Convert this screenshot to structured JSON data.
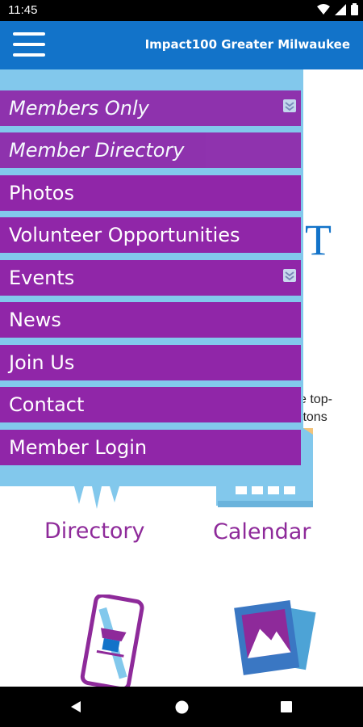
{
  "status_bar": {
    "time": "11:45"
  },
  "app_bar": {
    "title": "Impact100 Greater Milwaukee"
  },
  "menu": {
    "items": [
      {
        "label": "Members Only",
        "italic": true,
        "expandable": true
      },
      {
        "label": "Member Directory",
        "italic": true,
        "expandable": false
      },
      {
        "label": "Photos",
        "italic": false,
        "expandable": false
      },
      {
        "label": "Volunteer Opportunities",
        "italic": false,
        "expandable": false
      },
      {
        "label": "Events",
        "italic": false,
        "expandable": true
      },
      {
        "label": "News",
        "italic": false,
        "expandable": false
      },
      {
        "label": "Join Us",
        "italic": false,
        "expandable": false
      },
      {
        "label": "Contact",
        "italic": false,
        "expandable": false
      },
      {
        "label": "Member Login",
        "italic": false,
        "expandable": false
      }
    ]
  },
  "background": {
    "logo_fragment": "T",
    "text_line1": "e top-",
    "text_line2": "ttons",
    "tiles": [
      "Directory",
      "Calendar"
    ]
  },
  "colors": {
    "appbar": "#1273c9",
    "menu_item": "#9026a8",
    "menu_bg": "#82c8ec",
    "tile_label": "#8e2a9a"
  },
  "icons": [
    "wifi-icon",
    "signal-icon",
    "battery-icon",
    "hamburger-icon",
    "chevron-double-down-icon",
    "back-icon",
    "home-icon",
    "recents-icon"
  ]
}
